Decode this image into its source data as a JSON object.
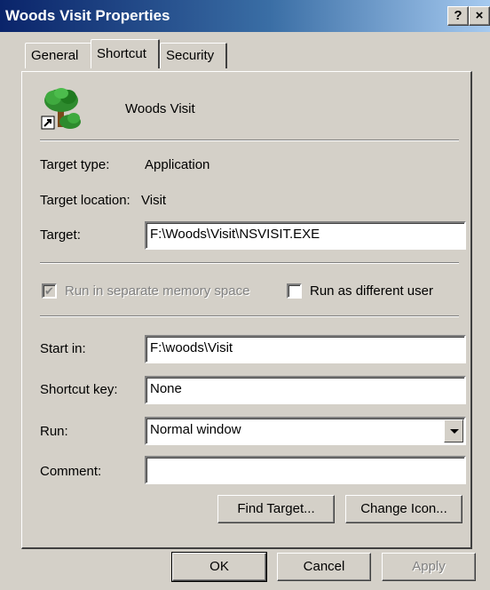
{
  "window": {
    "title": "Woods Visit Properties",
    "help_button": "?",
    "close_button": "×"
  },
  "tabs": [
    {
      "label": "General",
      "selected": false
    },
    {
      "label": "Shortcut",
      "selected": true
    },
    {
      "label": "Security",
      "selected": false
    }
  ],
  "shortcut": {
    "icon": "tree-shortcut-icon",
    "name": "Woods Visit",
    "target_type_label": "Target type:",
    "target_type_value": "Application",
    "target_location_label": "Target location:",
    "target_location_value": "Visit",
    "target_label": "Target:",
    "target_value": "F:\\Woods\\Visit\\NSVISIT.EXE",
    "run_separate_label": "Run in separate memory space",
    "run_separate_checked": true,
    "run_separate_disabled": true,
    "run_as_label": "Run as different user",
    "run_as_checked": false,
    "start_in_label": "Start in:",
    "start_in_value": "F:\\woods\\Visit",
    "shortcut_key_label": "Shortcut key:",
    "shortcut_key_value": "None",
    "run_label": "Run:",
    "run_value": "Normal window",
    "comment_label": "Comment:",
    "comment_value": "",
    "find_target_label": "Find Target...",
    "change_icon_label": "Change Icon..."
  },
  "footer": {
    "ok_label": "OK",
    "cancel_label": "Cancel",
    "apply_label": "Apply",
    "apply_disabled": true
  },
  "colors": {
    "title_bar_start": "#0a246a",
    "title_bar_end": "#a6caf0",
    "dialog_face": "#d4d0c8"
  }
}
